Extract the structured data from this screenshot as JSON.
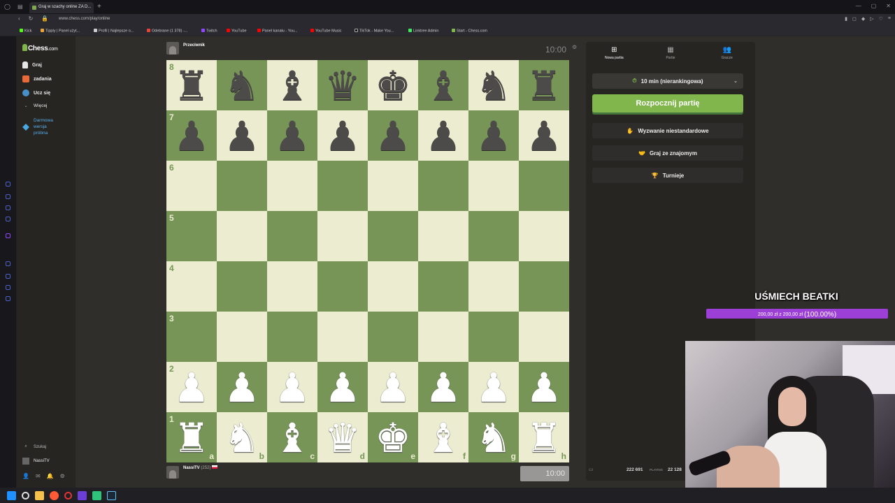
{
  "browser": {
    "tab_title": "Graj w szachy online ZA D...",
    "url": "www.chess.com/play/online",
    "bookmarks": [
      "Kick",
      "Tipply | Panel użyt...",
      "Profil | Najlepsze o...",
      "Odebrane (1 378) -...",
      "Twitch",
      "YouTube",
      "Panel kanału - You...",
      "YouTube Music",
      "TikTok - Make You...",
      "Linktree Admin",
      "Start - Chess.com"
    ]
  },
  "sidebar": {
    "logo": "Chess",
    "logo_suffix": ".com",
    "items": [
      {
        "label": "Graj"
      },
      {
        "label": "zadania"
      },
      {
        "label": "Ucz się"
      },
      {
        "label": "Więcej"
      }
    ],
    "promo": [
      "Darmowa",
      "wersja",
      "próbna"
    ],
    "search_label": "Szukaj",
    "user_label": "NassiTV"
  },
  "game": {
    "opponent": "Przeciwnik",
    "opponent_clock": "10:00",
    "player": "NassiTV",
    "player_rating": "(252)",
    "player_clock": "10:00"
  },
  "board": {
    "ranks": [
      "8",
      "7",
      "6",
      "5",
      "4",
      "3",
      "2",
      "1"
    ],
    "files": [
      "a",
      "b",
      "c",
      "d",
      "e",
      "f",
      "g",
      "h"
    ],
    "pieces": [
      [
        "br",
        "bn",
        "bb",
        "bq",
        "bk",
        "bb",
        "bn",
        "br"
      ],
      [
        "bp",
        "bp",
        "bp",
        "bp",
        "bp",
        "bp",
        "bp",
        "bp"
      ],
      [
        "",
        "",
        "",
        "",
        "",
        "",
        "",
        ""
      ],
      [
        "",
        "",
        "",
        "",
        "",
        "",
        "",
        ""
      ],
      [
        "",
        "",
        "",
        "",
        "",
        "",
        "",
        ""
      ],
      [
        "",
        "",
        "",
        "",
        "",
        "",
        "",
        ""
      ],
      [
        "wp",
        "wp",
        "wp",
        "wp",
        "wp",
        "wp",
        "wp",
        "wp"
      ],
      [
        "wr",
        "wn",
        "wb",
        "wq",
        "wk",
        "wb",
        "wn",
        "wr"
      ]
    ],
    "light_color": "#ebecd0",
    "dark_color": "#779556"
  },
  "panel": {
    "tabs": [
      {
        "label": "Nowa partia",
        "icon": "plus-icon"
      },
      {
        "label": "Partie",
        "icon": "board-icon"
      },
      {
        "label": "Gracze",
        "icon": "players-icon"
      }
    ],
    "time_control": "10 min (nierankingowa)",
    "start_button": "Rozpocznij partię",
    "custom_challenge": "Wyzwanie niestandardowe",
    "play_friend": "Graj ze znajomym",
    "tournaments": "Turnieje",
    "online_count": "222 691",
    "online_label": "PLAYING",
    "games_count": "22 128"
  },
  "overlay": {
    "goal_title": "UŚMIECH BEATKI",
    "goal_amounts": "200,00 zł z 200,00 zł",
    "goal_percent": "(100.00%)",
    "accent": "#9b3fd6"
  }
}
